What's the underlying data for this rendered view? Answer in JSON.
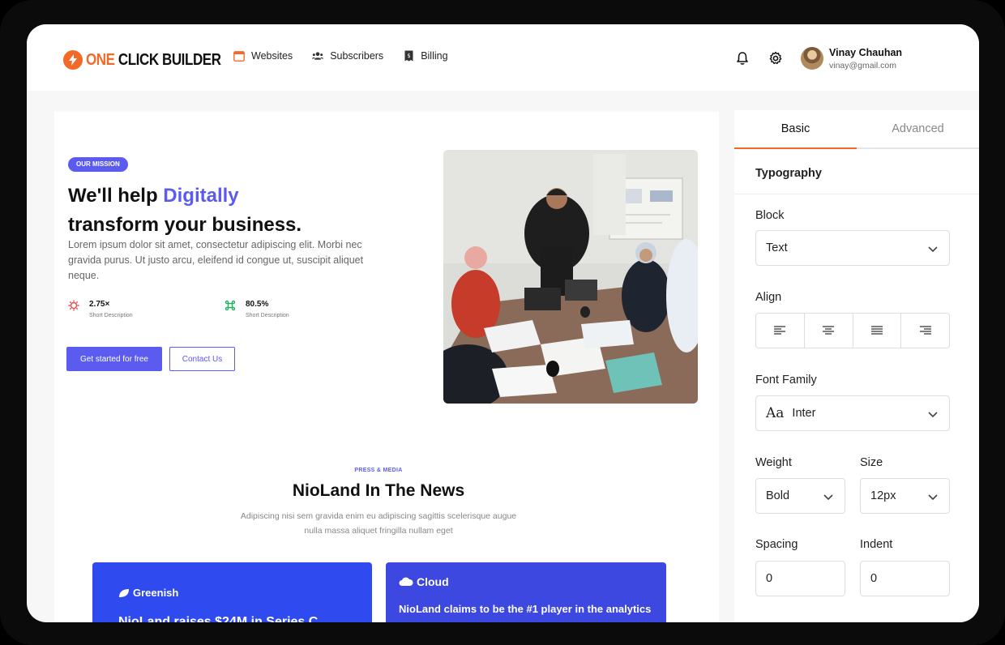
{
  "header": {
    "logo": {
      "one": "ONE",
      "rest": " CLICK BUILDER"
    },
    "nav": [
      {
        "label": "Websites",
        "icon": "browser-window-icon"
      },
      {
        "label": "Subscribers",
        "icon": "users-icon"
      },
      {
        "label": "Billing",
        "icon": "receipt-icon"
      }
    ],
    "user": {
      "name": "Vinay Chauhan",
      "email": "vinay@gmail.com"
    }
  },
  "hero": {
    "badge": "OUR MISSION",
    "headline_pre": "We'll help ",
    "headline_accent": "Digitally",
    "headline_post": "transform your business.",
    "lead": "Lorem ipsum dolor sit amet, consectetur adipiscing elit. Morbi nec gravida purus. Ut justo arcu, eleifend id congue ut, suscipit aliquet neque.",
    "stats": [
      {
        "value": "2.75×",
        "desc": "Short Description",
        "icon": "gear-bug-icon",
        "color": "#e5484d"
      },
      {
        "value": "80.5%",
        "desc": "Short Description",
        "icon": "command-icon",
        "color": "#22b35e"
      }
    ],
    "cta_primary": "Get started for free",
    "cta_secondary": "Contact Us"
  },
  "press": {
    "kicker": "PRESS & MEDIA",
    "title": "NioLand In The News",
    "subtitle": "Adipiscing nisi sem gravida enim eu adipiscing sagittis scelerisque augue nulla massa aliquet fringilla nullam eget",
    "cards": [
      {
        "brand": "Greenish",
        "text": "NioLand raises $24M in Series C"
      },
      {
        "brand": "Cloud",
        "text": "NioLand claims to be the #1 player in the analytics"
      }
    ]
  },
  "panel": {
    "tabs": [
      "Basic",
      "Advanced"
    ],
    "active_tab": "Basic",
    "section": "Typography",
    "block_label": "Block",
    "block_value": "Text",
    "align_label": "Align",
    "align_options": [
      "align-left-icon",
      "align-center-icon",
      "align-justify-icon",
      "align-right-icon"
    ],
    "font_family_label": "Font Family",
    "font_family_glyph": "Aa",
    "font_family_value": "Inter",
    "weight_label": "Weight",
    "weight_value": "Bold",
    "size_label": "Size",
    "size_value": "12px",
    "spacing_label": "Spacing",
    "spacing_value": "0",
    "indent_label": "Indent",
    "indent_value": "0"
  },
  "colors": {
    "accent": "#5b5bf0",
    "brand_orange": "#f26a2a"
  }
}
